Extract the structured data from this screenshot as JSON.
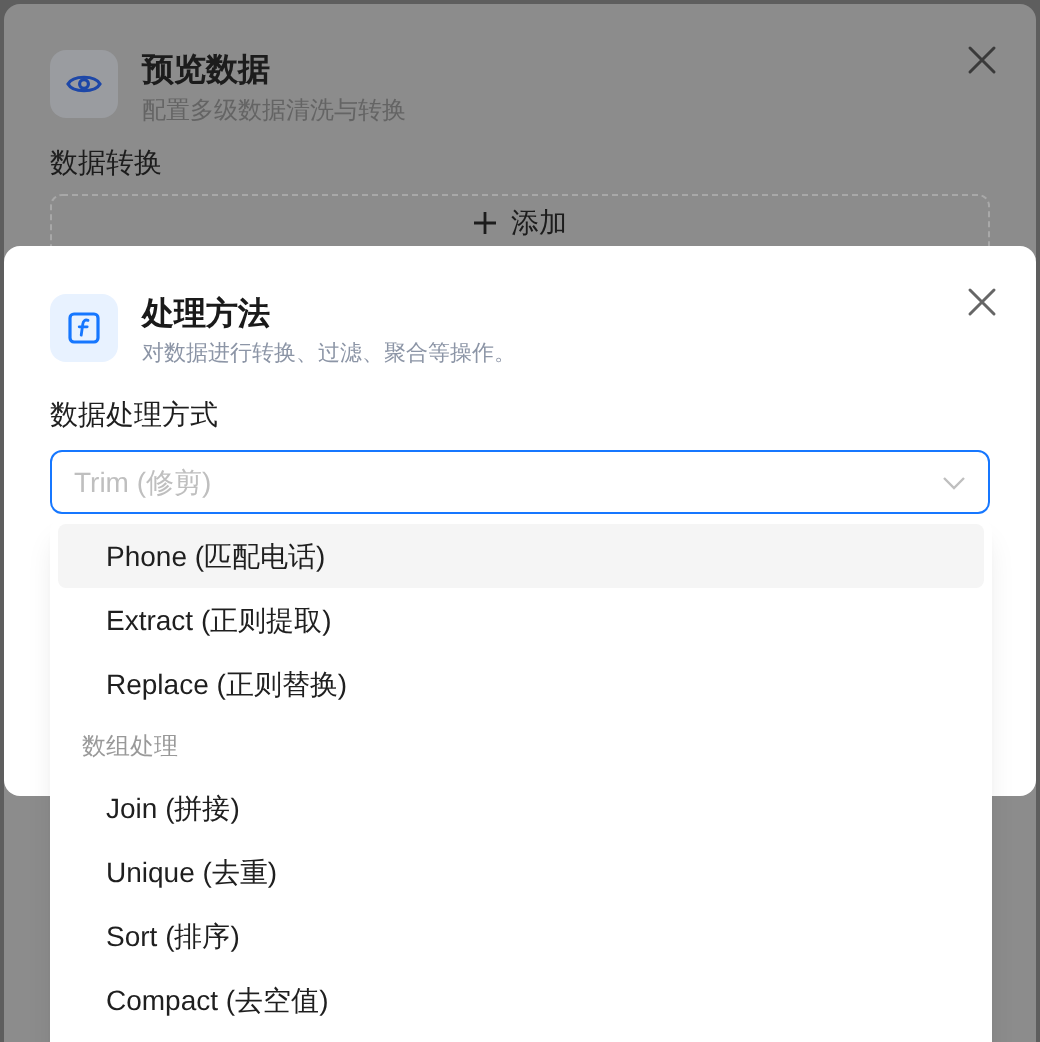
{
  "background_dialog": {
    "title": "预览数据",
    "subtitle": "配置多级数据清洗与转换",
    "section_label": "数据转换",
    "add_button": "添加"
  },
  "dialog": {
    "title": "处理方法",
    "subtitle": "对数据进行转换、过滤、聚合等操作。",
    "field_label": "数据处理方式",
    "select": {
      "placeholder": "Trim (修剪)",
      "open": true
    }
  },
  "dropdown": {
    "items": [
      {
        "kind": "option",
        "label": "Phone (匹配电话)",
        "highlighted": true
      },
      {
        "kind": "option",
        "label": "Extract (正则提取)",
        "highlighted": false
      },
      {
        "kind": "option",
        "label": "Replace (正则替换)",
        "highlighted": false
      },
      {
        "kind": "group",
        "label": "数组处理"
      },
      {
        "kind": "option",
        "label": "Join (拼接)",
        "highlighted": false
      },
      {
        "kind": "option",
        "label": "Unique (去重)",
        "highlighted": false
      },
      {
        "kind": "option",
        "label": "Sort (排序)",
        "highlighted": false
      },
      {
        "kind": "option",
        "label": "Compact (去空值)",
        "highlighted": false
      }
    ]
  }
}
